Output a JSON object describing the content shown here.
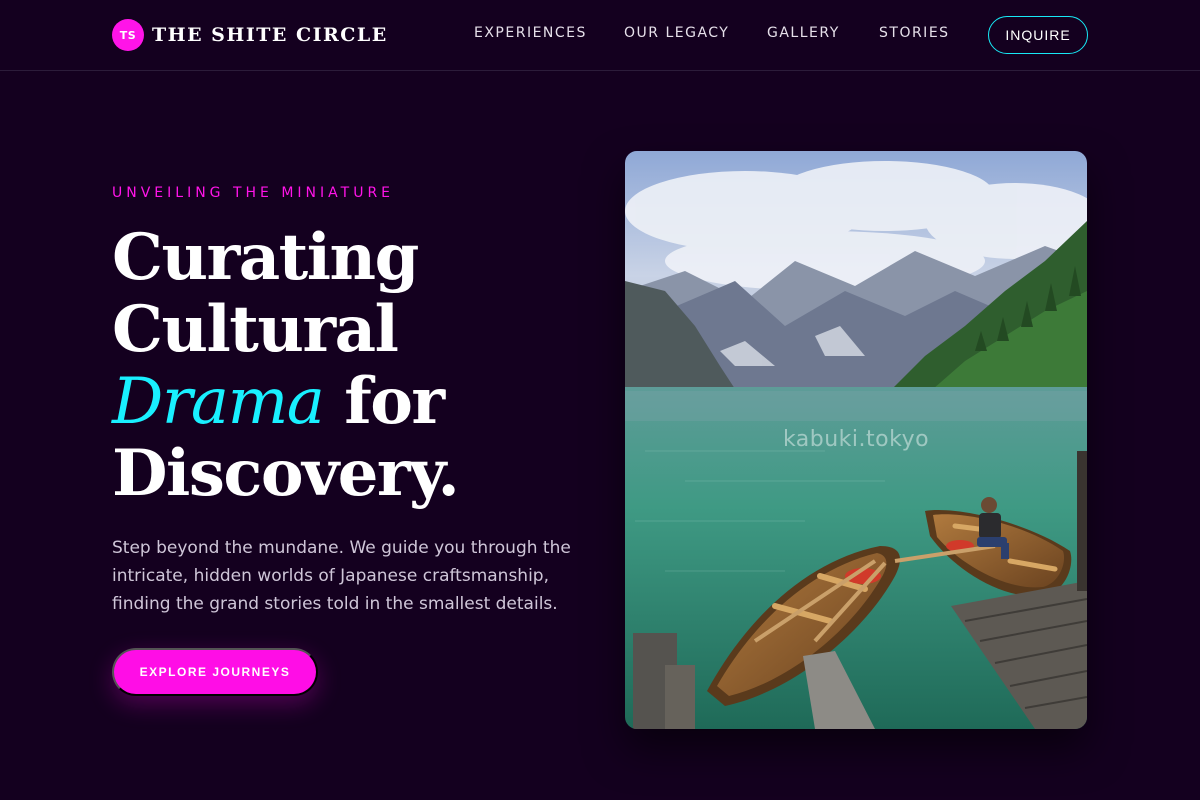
{
  "brand": {
    "badge": "TS",
    "name": "THE SHITE CIRCLE"
  },
  "nav": {
    "links": [
      "EXPERIENCES",
      "OUR LEGACY",
      "GALLERY",
      "STORIES"
    ],
    "cta": "INQUIRE"
  },
  "hero": {
    "eyebrow": "UNVEILING THE MINIATURE",
    "headline": {
      "line1": "Curating",
      "line2": "Cultural",
      "accent": "Drama",
      "line3_rest": " for",
      "line4": "Discovery."
    },
    "lede": "Step beyond the mundane. We guide you through the intricate, hidden worlds of Japanese craftsmanship, finding the grand stories told in the smallest details.",
    "cta": "EXPLORE JOURNEYS"
  },
  "photo": {
    "watermark": "kabuki.tokyo",
    "subject": "mountain-lake-rowboats-photo"
  },
  "colors": {
    "background": "#14001f",
    "magenta": "#ff14e8",
    "cyan": "#19f0ff"
  }
}
